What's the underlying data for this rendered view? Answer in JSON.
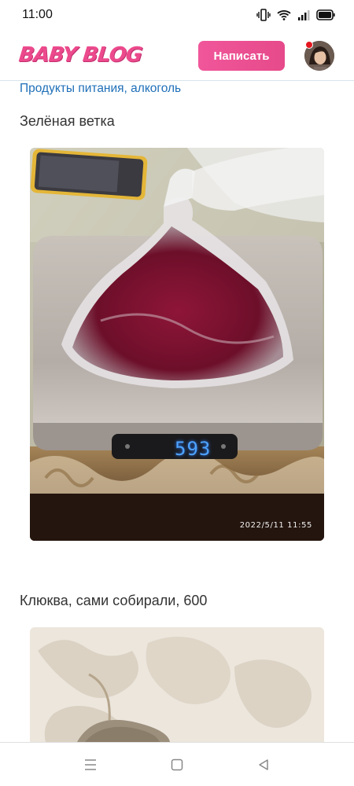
{
  "status_bar": {
    "time": "11:00"
  },
  "header": {
    "logo": "BABY BLOG",
    "write_button": "Написать"
  },
  "category": {
    "label": "Продукты питания, алкоголь"
  },
  "posts": [
    {
      "caption": "Зелёная ветка",
      "scale_reading": "593",
      "timestamp": "2022/5/11 11:55"
    },
    {
      "caption": "Клюква, сами собирали, 600"
    }
  ],
  "nav": {
    "icons": [
      "menu-icon",
      "home-square-icon",
      "back-triangle-icon"
    ]
  },
  "colors": {
    "accent": "#ec4a8c",
    "link": "#1f6fb8"
  }
}
